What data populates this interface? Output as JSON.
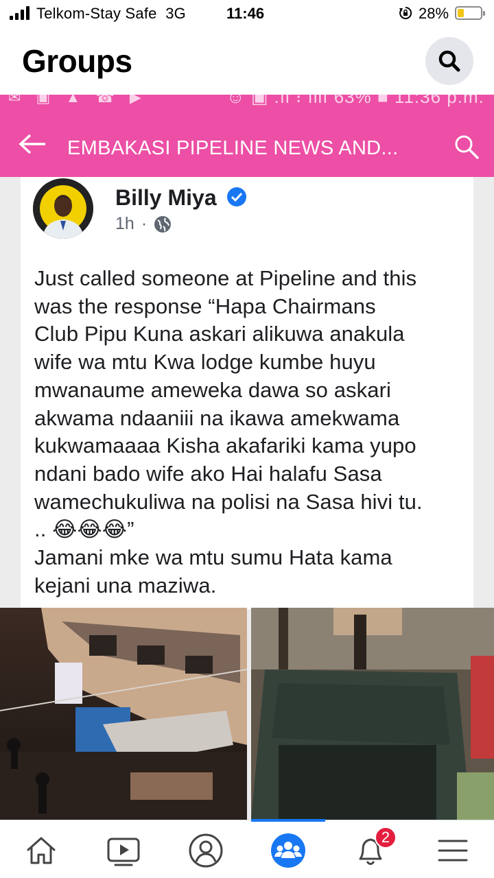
{
  "status_bar": {
    "carrier": "Telkom-Stay Safe",
    "network": "3G",
    "time": "11:46",
    "battery_percent": "28%",
    "battery_level": 0.28,
    "signal_bars": 4
  },
  "header": {
    "title": "Groups",
    "search_icon": "search-icon"
  },
  "screenshot": {
    "status_bar": {
      "left_icons": "✉ ▣ ▲ ☎ ▶",
      "right_text": "☺ ▣ .ıl ⁝ ıllı 63% ■ 11:36 p.m."
    },
    "app_bar": {
      "group_name": "EMBAKASI PIPELINE NEWS AND...",
      "back_icon": "back-arrow-icon",
      "search_icon": "search-icon"
    },
    "post": {
      "author": "Billy Miya",
      "verified": true,
      "time": "1h",
      "separator": "·",
      "audience_icon": "globe-icon",
      "text": "Just called someone at Pipeline and this\nwas the response “Hapa Chairmans\nClub Pipu Kuna askari alikuwa anakula\nwife wa mtu Kwa lodge kumbe huyu\nmwanaume ameweka dawa so askari\nakwama ndaaniii na ikawa amekwama\nkukwamaaaa Kisha akafariki kama yupo\nndani bado wife ako Hai halafu Sasa\nwamechukuliwa na polisi na Sasa hivi tu.\n.. 😂😂😂”\nJamani mke wa mtu sumu Hata kama\nkejani una maziwa."
    }
  },
  "bottom_nav": {
    "items": [
      {
        "icon": "home-icon",
        "active": false
      },
      {
        "icon": "video-icon",
        "active": false
      },
      {
        "icon": "profile-icon",
        "active": false
      },
      {
        "icon": "groups-icon",
        "active": true
      },
      {
        "icon": "notifications-icon",
        "active": false,
        "badge": "2"
      },
      {
        "icon": "menu-icon",
        "active": false
      }
    ],
    "accent_color": "#1877f2",
    "badge_color": "#e41e3f"
  },
  "colors": {
    "embedded_app_bar": "#ec4fa5",
    "search_button_bg": "#e4e6eb"
  }
}
